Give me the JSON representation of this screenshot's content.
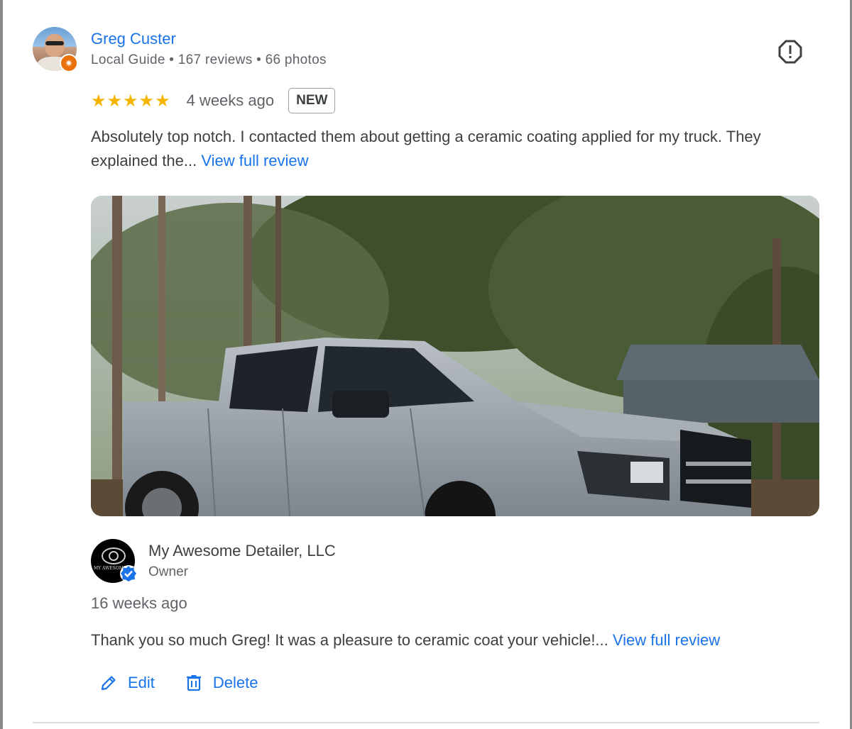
{
  "reviewer": {
    "name": "Greg Custer",
    "meta": "Local Guide • 167 reviews • 66 photos",
    "badge_icon": "local-guide-star-icon"
  },
  "review": {
    "stars": "★★★★★",
    "rating": 5,
    "date": "4 weeks ago",
    "badge": "NEW",
    "text": "Absolutely top notch. I contacted them about getting a ceramic coating applied for my truck. They explained the... ",
    "more_link": "View full review"
  },
  "owner_reply": {
    "name": "My Awesome Detailer, LLC",
    "role": "Owner",
    "logo_text": "MY AWESOME DE",
    "date": "16 weeks ago",
    "text": "Thank you so much Greg! It was a pleasure to ceramic coat your vehicle!... ",
    "more_link": "View full review"
  },
  "actions": {
    "edit": "Edit",
    "delete": "Delete"
  },
  "colors": {
    "link": "#1a73e8",
    "star": "#f4b400",
    "guide_badge": "#e8710a"
  }
}
